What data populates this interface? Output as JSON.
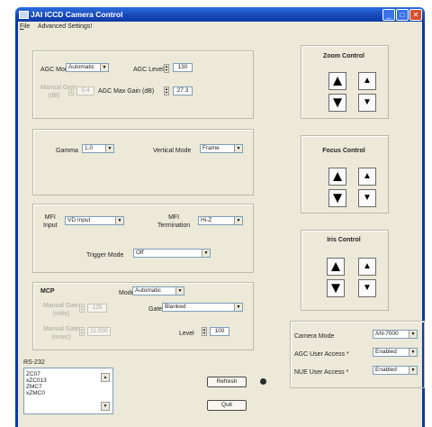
{
  "window": {
    "title": "JAI ICCD Camera Control"
  },
  "menu": {
    "file": "ile",
    "file_accel": "F",
    "advanced": "Advanced Settings!"
  },
  "agc": {
    "mode_label": "AGC Mode",
    "mode_value": "Automatic",
    "level_label": "AGC Level",
    "level_value": "130",
    "manual_gain_label_1": "Manual Gain",
    "manual_gain_label_2": "(dB)",
    "manual_gain_value": "5.4",
    "max_gain_label": "AGC Max Gain (dB)",
    "max_gain_value": "27.3"
  },
  "gamma": {
    "label": "Gamma",
    "value": "1.0",
    "vmode_label": "Vertical Mode",
    "vmode_value": "Frame"
  },
  "trigger": {
    "mfi_input_label_1": "MFI",
    "mfi_input_label_2": "Input",
    "mfi_input_value": "VD Input",
    "mfi_term_label_1": "MFI",
    "mfi_term_label_2": "Termination",
    "mfi_term_value": "Hi-Z",
    "mode_label": "Trigger Mode",
    "mode_value": "Off"
  },
  "mcp": {
    "title": "MCP",
    "mode_label": "Mode",
    "mode_value": "Automatic",
    "volts_label_1": "Manual Gain",
    "volts_label_2": "(volts)",
    "volts_value": "125",
    "gate_label": "Gate",
    "gate_value": "Blanked",
    "time_label_1": "Manual Gate",
    "time_label_2": "(msec)",
    "time_value": "11.000",
    "level_label": "Level",
    "level_value": "100"
  },
  "zoom": {
    "title": "Zoom Control"
  },
  "focus": {
    "title": "Focus Control"
  },
  "iris": {
    "title": "Iris Control"
  },
  "camera": {
    "mode_label": "Camera Mode",
    "mode_value": "AN-7000",
    "agc_access_label": "AGC User Access *",
    "agc_access_value": "Enabled",
    "nue_access_label": "NUE User Access *",
    "nue_access_value": "Enabled"
  },
  "rs232": {
    "label": "RS-232",
    "lines": [
      "ZC07",
      "xZC013",
      "ZMC7",
      "xZMC0"
    ]
  },
  "buttons": {
    "refresh": "Refresh",
    "quit": "Quit"
  },
  "colors": {
    "title_bar": "#1747b8",
    "dialog": "#ece9d8",
    "close": "#d8502c"
  }
}
